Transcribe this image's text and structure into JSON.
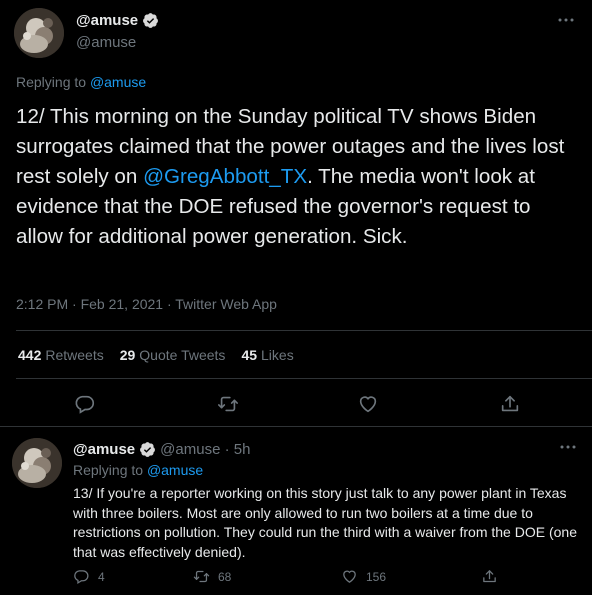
{
  "main_tweet": {
    "display_name": "@amuse",
    "handle": "@amuse",
    "replying_prefix": "Replying to ",
    "replying_to": "@amuse",
    "text_part1": "12/ This morning on the Sunday political TV shows Biden surrogates claimed that the power outages and the lives lost rest solely on ",
    "mention": "@GregAbbott_TX",
    "text_part2": ". The media won't look at evidence that the DOE refused the governor's request to allow for additional power generation. Sick.",
    "timestamp": "2:12 PM · Feb 21, 2021 · Twitter Web App",
    "stats": {
      "retweets_count": "442",
      "retweets_label": "Retweets",
      "quotes_count": "29",
      "quotes_label": "Quote Tweets",
      "likes_count": "45",
      "likes_label": "Likes"
    },
    "action_icons": [
      "reply-icon",
      "retweet-icon",
      "like-icon",
      "share-icon"
    ]
  },
  "reply_tweet": {
    "display_name": "@amuse",
    "handle_time": "@amuse · 5h",
    "replying_prefix": "Replying to ",
    "replying_to": "@amuse",
    "text": "13/ If you're a reporter working on this story just talk to any power plant in Texas with three boilers. Most are only allowed to run two boilers at a time due to restrictions on pollution. They could run the third with a waiver from the DOE (one that was effectively denied).",
    "reply_count": "4",
    "retweet_count": "68",
    "like_count": "156"
  },
  "colors": {
    "background": "#000000",
    "accent": "#1d9bf0",
    "muted": "#6e767d",
    "text": "#e7e9ea"
  }
}
